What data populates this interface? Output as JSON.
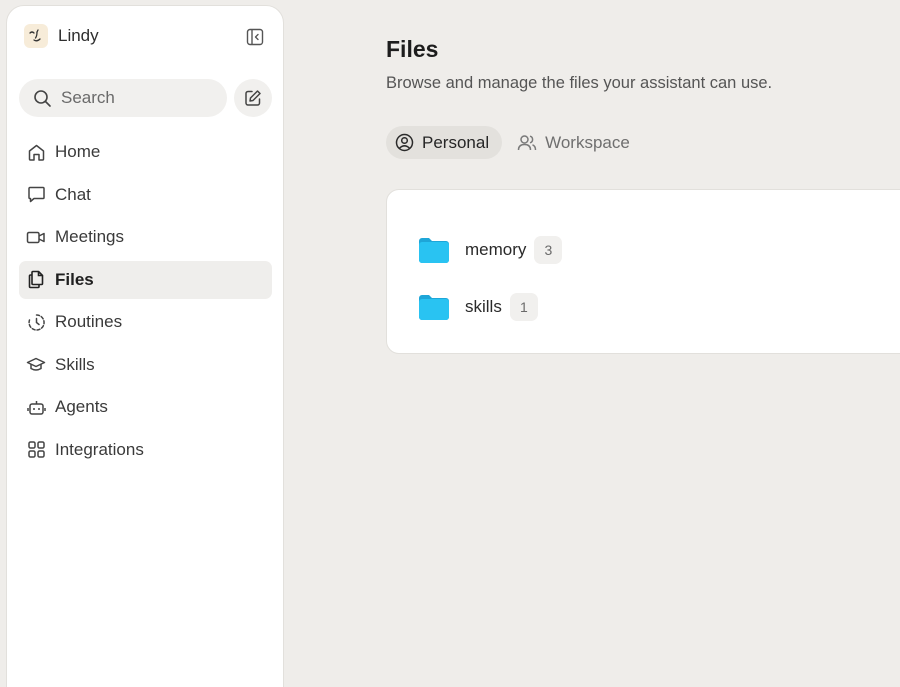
{
  "sidebar": {
    "brand_name": "Lindy",
    "search_label": "Search",
    "nav": [
      {
        "label": "Home",
        "icon": "home-icon"
      },
      {
        "label": "Chat",
        "icon": "chat-icon"
      },
      {
        "label": "Meetings",
        "icon": "video-icon"
      },
      {
        "label": "Files",
        "icon": "files-icon",
        "active": true
      },
      {
        "label": "Routines",
        "icon": "routine-icon"
      },
      {
        "label": "Skills",
        "icon": "graduation-cap-icon"
      },
      {
        "label": "Agents",
        "icon": "robot-icon"
      },
      {
        "label": "Integrations",
        "icon": "grid-icon"
      }
    ]
  },
  "main": {
    "title": "Files",
    "subtitle": "Browse and manage the files your assistant can use.",
    "tabs": [
      {
        "label": "Personal",
        "icon": "user-circle-icon",
        "active": true
      },
      {
        "label": "Workspace",
        "icon": "users-icon",
        "active": false
      }
    ],
    "folders": [
      {
        "name": "memory",
        "count": "3"
      },
      {
        "name": "skills",
        "count": "1"
      }
    ]
  },
  "colors": {
    "background": "#efedea",
    "folder": "#29bfef",
    "active_item": "#efeeec"
  }
}
